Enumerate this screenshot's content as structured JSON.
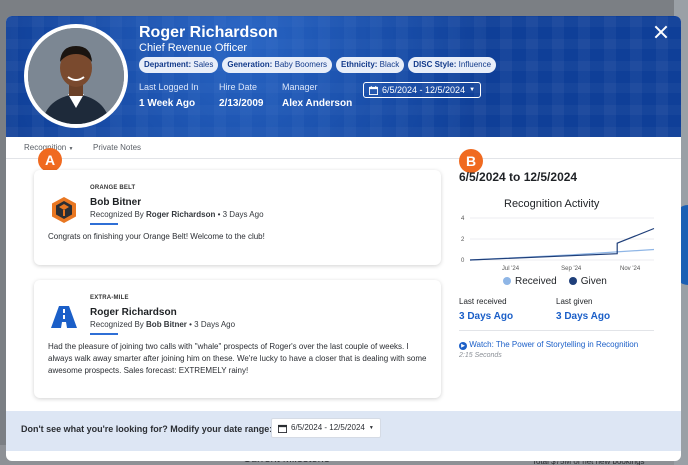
{
  "profile": {
    "name": "Roger Richardson",
    "title": "Chief Revenue Officer",
    "chips": [
      {
        "label": "Department:",
        "value": "Sales"
      },
      {
        "label": "Generation:",
        "value": "Baby Boomers"
      },
      {
        "label": "Ethnicity:",
        "value": "Black"
      },
      {
        "label": "DISC Style:",
        "value": "Influence"
      }
    ],
    "meta": [
      {
        "label": "Last Logged In",
        "value": "1 Week Ago"
      },
      {
        "label": "Hire Date",
        "value": "2/13/2009"
      },
      {
        "label": "Manager",
        "value": "Alex Anderson"
      }
    ],
    "date_range": "6/5/2024 - 12/5/2024"
  },
  "tabs": {
    "recognition": "Recognition",
    "private_notes": "Private Notes"
  },
  "badges": {
    "a": "A",
    "b": "B"
  },
  "feed": [
    {
      "kind": "ORANGE BELT",
      "who": "Bob Bitner",
      "by_prefix": "Recognized By ",
      "by_name": "Roger Richardson",
      "when": " • 3 Days Ago",
      "message": "Congrats on finishing your Orange Belt! Welcome to the club!",
      "icon": "orange-belt-icon",
      "icon_color": "#e87722"
    },
    {
      "kind": "EXTRA-MILE",
      "who": "Roger Richardson",
      "by_prefix": "Recognized By ",
      "by_name": "Bob Bitner",
      "when": " • 3 Days Ago",
      "message_lines": [
        "Had the pleasure of joining two calls with \"whale\" prospects of Roger's over the last couple of weeks. I",
        "always walk away smarter after joining him on these. We're lucky to have a closer that is dealing with some",
        "awesome prospects. Sales forecast: EXTREMELY rainy!"
      ],
      "icon": "highway-icon",
      "icon_color": "#1b5fc8"
    }
  ],
  "activity": {
    "range_title": "6/5/2024 to 12/5/2024",
    "chart_title": "Recognition Activity",
    "last_received_label": "Last received",
    "last_received_value": "3 Days Ago",
    "last_given_label": "Last given",
    "last_given_value": "3 Days Ago",
    "watch_link": "Watch: The Power of Storytelling in Recognition",
    "watch_duration": "2:15 Seconds"
  },
  "chart_data": {
    "type": "line",
    "title": "Recognition Activity",
    "x_ticks": [
      "Jul '24",
      "Sep '24",
      "Nov '24"
    ],
    "y_ticks": [
      0,
      2,
      4
    ],
    "ylim": [
      0,
      4
    ],
    "series": [
      {
        "name": "Received",
        "color": "#8fb6e6",
        "points": [
          [
            0,
            0
          ],
          [
            0.55,
            0.5
          ],
          [
            1,
            1.0
          ]
        ]
      },
      {
        "name": "Given",
        "color": "#1f3f7a",
        "points": [
          [
            0,
            0
          ],
          [
            0.8,
            0.6
          ],
          [
            0.8,
            1.6
          ],
          [
            1,
            3.0
          ]
        ]
      }
    ]
  },
  "footer": {
    "question": "Don't see what you're looking for? Modify your date range:",
    "date_range": "6/5/2024 - 12/5/2024"
  },
  "backdrop": {
    "milestone": "Current Milestone",
    "booking": "Total $75M of net new bookings"
  },
  "colors": {
    "header_blue": "#0f3f98",
    "accent_orange": "#f06a20",
    "link_blue": "#1b5fc8"
  }
}
